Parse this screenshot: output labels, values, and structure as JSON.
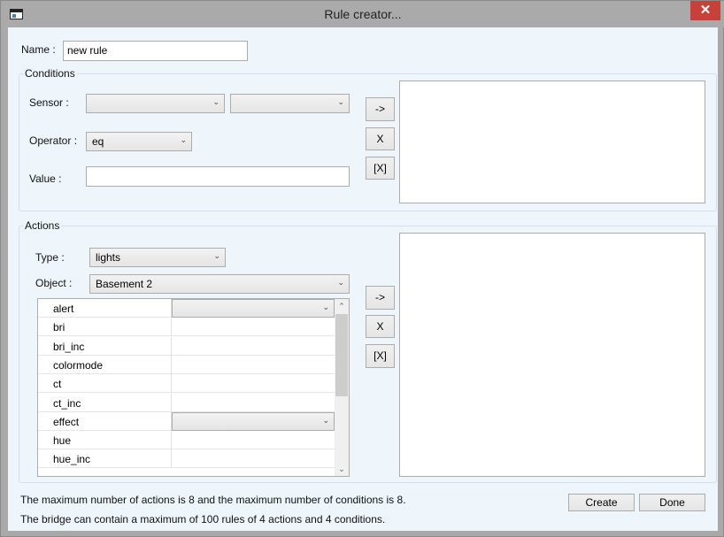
{
  "window": {
    "title": "Rule creator...",
    "close_glyph": "✕"
  },
  "name": {
    "label": "Name :",
    "value": "new rule"
  },
  "conditions": {
    "group_label": "Conditions",
    "sensor_label": "Sensor :",
    "sensor_select_1": "",
    "sensor_select_2": "",
    "operator_label": "Operator :",
    "operator_value": "eq",
    "value_label": "Value :",
    "value_input": "",
    "add_button": "->",
    "remove_button": "X",
    "clear_button": "[X]"
  },
  "actions": {
    "group_label": "Actions",
    "type_label": "Type :",
    "type_value": "lights",
    "object_label": "Object :",
    "object_value": "Basement 2",
    "add_button": "->",
    "remove_button": "X",
    "clear_button": "[X]",
    "properties": [
      {
        "name": "alert",
        "has_dropdown": true
      },
      {
        "name": "bri",
        "has_dropdown": false
      },
      {
        "name": "bri_inc",
        "has_dropdown": false
      },
      {
        "name": "colormode",
        "has_dropdown": false
      },
      {
        "name": "ct",
        "has_dropdown": false
      },
      {
        "name": "ct_inc",
        "has_dropdown": false
      },
      {
        "name": "effect",
        "has_dropdown": true
      },
      {
        "name": "hue",
        "has_dropdown": false
      },
      {
        "name": "hue_inc",
        "has_dropdown": false
      }
    ]
  },
  "footer": {
    "note_1": "The maximum number of actions is 8 and the maximum number of conditions is 8.",
    "note_2": "The bridge can contain a maximum of 100 rules of 4 actions and 4 conditions.",
    "create_button": "Create",
    "done_button": "Done"
  },
  "icons": {
    "dropdown": "chevron-down-icon",
    "scroll_up": "scroll-up-icon",
    "scroll_down": "scroll-down-icon"
  },
  "colors": {
    "close": "#c7403a",
    "client_bg": "#eef5fb"
  }
}
